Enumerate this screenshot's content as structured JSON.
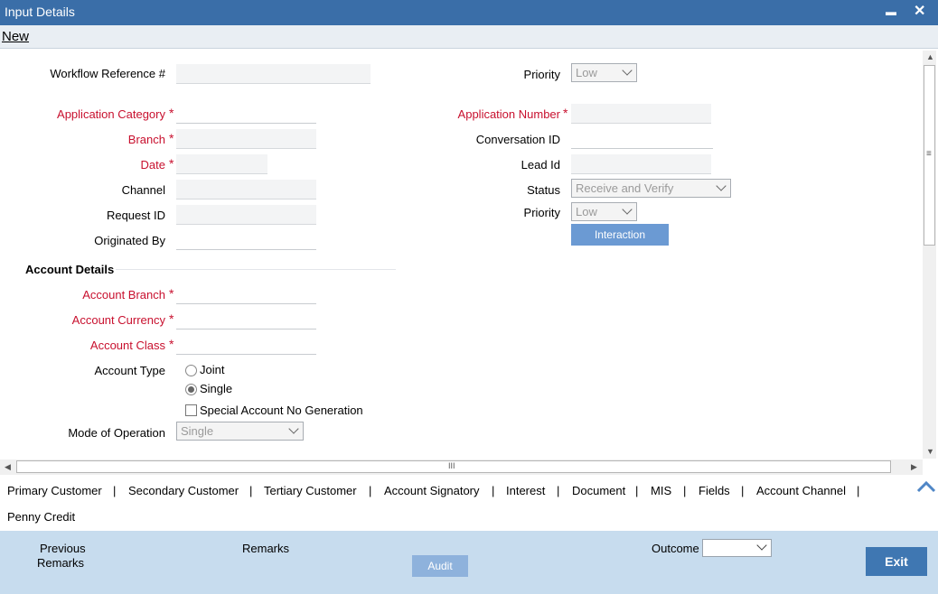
{
  "window": {
    "title": "Input Details",
    "minimize": "▬",
    "close": "✕"
  },
  "menu": {
    "new_label": "New"
  },
  "form": {
    "workflow_ref_label": "Workflow Reference #",
    "workflow_ref_value": "",
    "priority_top_label": "Priority",
    "priority_top_value": "Low",
    "app_category_label": "Application Category",
    "app_number_label": "Application Number",
    "branch_label": "Branch",
    "conversation_label": "Conversation ID",
    "date_label": "Date",
    "lead_label": "Lead Id",
    "channel_label": "Channel",
    "status_label": "Status",
    "status_value": "Receive and Verify",
    "request_label": "Request ID",
    "priority_label": "Priority",
    "priority_value": "Low",
    "originated_label": "Originated By",
    "interaction_label": "Interaction",
    "required_star": "*"
  },
  "account": {
    "section_title": "Account Details",
    "branch_label": "Account Branch",
    "currency_label": "Account Currency",
    "class_label": "Account Class",
    "type_label": "Account Type",
    "type_joint": "Joint",
    "type_single": "Single",
    "special_label": "Special Account No Generation",
    "mode_label": "Mode of Operation",
    "mode_value": "Single"
  },
  "tabs": [
    "Primary Customer",
    "Secondary Customer",
    "Tertiary Customer",
    "Account Signatory",
    "Interest",
    "Document",
    "MIS",
    "Fields",
    "Account Channel",
    "Penny Credit"
  ],
  "tab_separator": "|",
  "footer": {
    "prev_remarks_1": "Previous",
    "prev_remarks_2": "Remarks",
    "remarks_label": "Remarks",
    "audit_label": "Audit",
    "outcome_label": "Outcome",
    "exit_label": "Exit"
  },
  "scrollbar": {
    "grip": "≡",
    "hgrip": "III"
  }
}
